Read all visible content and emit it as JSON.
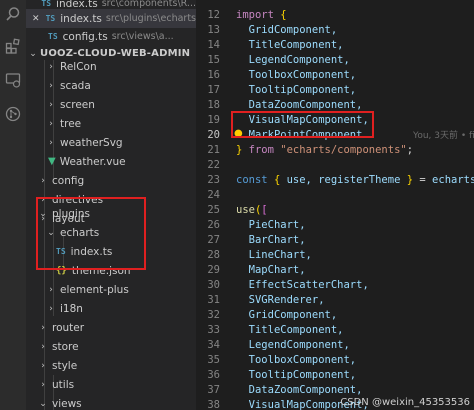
{
  "sidebar": {
    "open_editors": [
      {
        "name": "index.ts",
        "path": "src\\components\\R..."
      },
      {
        "name": "index.ts",
        "path": "src\\plugins\\echarts"
      },
      {
        "name": "config.ts",
        "path": "src\\views\\a..."
      }
    ],
    "project_title": "UOOZ-CLOUD-WEB-ADMIN",
    "tree": [
      {
        "label": "RelCon"
      },
      {
        "label": "scada"
      },
      {
        "label": "screen"
      },
      {
        "label": "tree"
      },
      {
        "label": "weatherSvg"
      },
      {
        "label": "Weather.vue"
      },
      {
        "label": "config"
      },
      {
        "label": "directives"
      },
      {
        "label": "layout"
      },
      {
        "label": "plugins"
      },
      {
        "label": "echarts"
      },
      {
        "label": "index.ts"
      },
      {
        "label": "theme.json"
      },
      {
        "label": "element-plus"
      },
      {
        "label": "i18n"
      },
      {
        "label": "router"
      },
      {
        "label": "store"
      },
      {
        "label": "style"
      },
      {
        "label": "utils"
      },
      {
        "label": "views"
      },
      {
        "label": "account"
      },
      {
        "label": "admin"
      }
    ]
  },
  "editor": {
    "line_numbers": [
      "12",
      "13",
      "14",
      "15",
      "16",
      "17",
      "18",
      "19",
      "20",
      "21",
      "22",
      "23",
      "24",
      "25",
      "26",
      "27",
      "28",
      "29",
      "30",
      "31",
      "32",
      "33",
      "34",
      "35",
      "36",
      "37",
      "38",
      "39",
      "40"
    ],
    "lines": {
      "l12_kw": "import",
      "l12_b": "{",
      "l13": "GridComponent,",
      "l14": "TitleComponent,",
      "l15": "LegendComponent,",
      "l16": "ToolboxComponent,",
      "l17": "TooltipComponent,",
      "l18": "DataZoomComponent,",
      "l19": "VisualMapComponent,",
      "l20": "MarkPointComponent",
      "l20_blame": "You, 3天前 • fix:",
      "l21_b": "}",
      "l21_kw": "from",
      "l21_str": "\"echarts/components\"",
      "l21_end": ";",
      "l23_const": "const",
      "l23_b1": "{",
      "l23_use": "use,",
      "l23_reg": "registerTheme",
      "l23_b2": "}",
      "l23_eq": "=",
      "l23_ech": "echarts",
      "l23_end": ";",
      "l25_use": "use",
      "l25_p": "(",
      "l25_sq": "[",
      "l26": "PieChart,",
      "l27": "BarChart,",
      "l28": "LineChart,",
      "l29": "MapChart,",
      "l30": "EffectScatterChart,",
      "l31": "SVGRenderer,",
      "l32": "GridComponent,",
      "l33": "TitleComponent,",
      "l34": "LegendComponent,",
      "l35": "ToolboxComponent,",
      "l36": "TooltipComponent,",
      "l37": "DataZoomComponent,",
      "l38": "VisualMapComponent,",
      "l39": "MarkPointComponent",
      "l40_sq": "]",
      "l40_p": ")",
      "l40_end": ";"
    }
  },
  "watermark": "CSDN @weixin_45353536"
}
